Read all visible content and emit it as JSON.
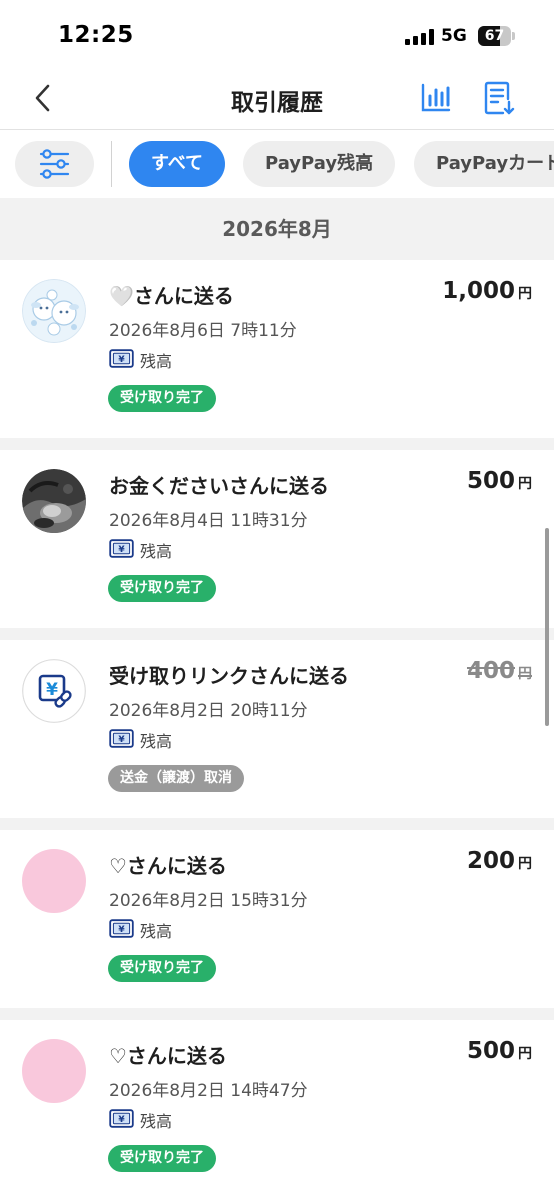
{
  "status_bar": {
    "time": "12:25",
    "network": "5G",
    "battery": "67",
    "battery_level": 0.67
  },
  "header": {
    "back_icon": "chevron-left-icon",
    "title": "取引履歴",
    "chart_icon": "bar-chart-icon",
    "export_icon": "document-download-icon"
  },
  "filters": {
    "filter_icon": "sliders-icon",
    "chips": [
      "すべて",
      "PayPay残高",
      "PayPayカード"
    ],
    "active": "すべて",
    "accent_color": "#2f86f0"
  },
  "month": "2026年8月",
  "transactions": [
    {
      "title": "🤍さんに送る",
      "date": "2026年8月6日 7時11分",
      "source": "残高",
      "status": "受け取り完了",
      "amount": "1,000",
      "currency": "円",
      "avatar": "character-illustration-avatar"
    },
    {
      "title": "お金くださいさんに送る",
      "date": "2026年8月4日 11時31分",
      "source": "残高",
      "status": "受け取り完了",
      "amount": "500",
      "currency": "円",
      "avatar": "dark-photo-avatar"
    },
    {
      "title": "受け取りリンクさんに送る",
      "date": "2026年8月2日 20時11分",
      "source": "残高",
      "status": "送金（譲渡）取消",
      "amount": "400",
      "currency": "円",
      "avatar": "yen-link-icon"
    },
    {
      "title": "♡さんに送る",
      "date": "2026年8月2日 15時31分",
      "source": "残高",
      "status": "受け取り完了",
      "amount": "200",
      "currency": "円",
      "avatar": "pink-circle-avatar"
    },
    {
      "title": "♡さんに送る",
      "date": "2026年8月2日 14時47分",
      "source": "残高",
      "status": "受け取り完了",
      "amount": "500",
      "currency": "円",
      "avatar": "pink-circle-avatar"
    }
  ],
  "colors": {
    "status_done": "#29b06a",
    "status_cancel": "#9a9a9a",
    "balance_icon": "#1a3a8a",
    "avatar_pink": "#f9c8dc"
  }
}
